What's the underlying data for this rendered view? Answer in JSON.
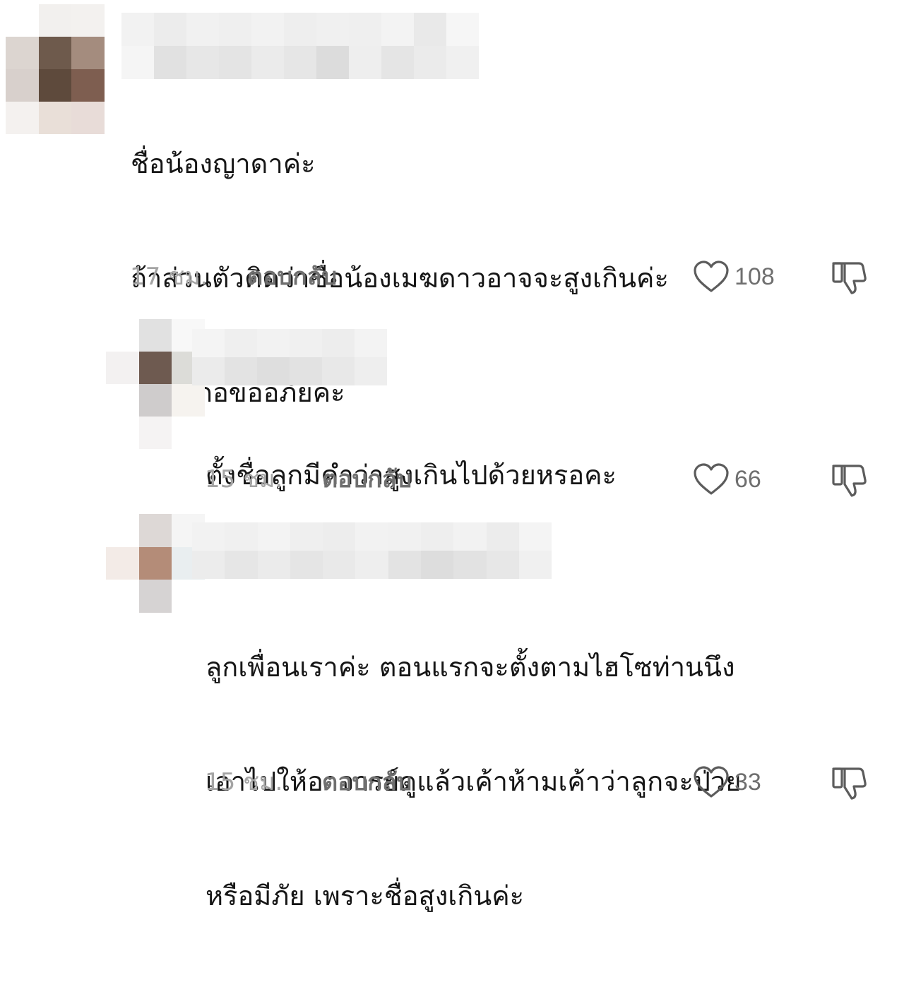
{
  "colors": {
    "text": "#161616",
    "muted_time": "#a4a4a4",
    "reply": "#6f6f6f",
    "icon": "#5c5c5c"
  },
  "comments": [
    {
      "lines": [
        "ชื่อน้องญาดาค่ะ",
        "ถ้าส่วนตัวคิดว่าชื่อน้องเมฆดาวอาจจะสูงเกินค่ะ",
        "ผิดถูกก้อขออภัยค่ะ"
      ],
      "time": "17 ชม.",
      "reply_label": "ตอบกลับ",
      "likes": "108",
      "like_icon": "heart-outline-icon",
      "dislike_icon": "thumbs-down-outline-icon"
    },
    {
      "lines": [
        "ตั้งชื่อลูกมีคำว่าสูงเกินไปด้วยหรอคะ"
      ],
      "time": "15 ชม.",
      "reply_label": "ตอบกลับ",
      "likes": "66",
      "like_icon": "heart-outline-icon",
      "dislike_icon": "thumbs-down-outline-icon"
    },
    {
      "lines": [
        "ลูกเพื่อนเราค่ะ ตอนแรกจะตั้งตามไฮโซท่านนึง",
        "เอาไปให้อาจารย์ดูแล้วเค้าห้ามเค้าว่าลูกจะป่วย",
        "หรือมีภัย เพราะชื่อสูงเกินค่ะ"
      ],
      "time": "15 ชม.",
      "reply_label": "ตอบกลับ",
      "likes": "33",
      "like_icon": "heart-outline-icon",
      "dislike_icon": "thumbs-down-outline-icon"
    }
  ]
}
